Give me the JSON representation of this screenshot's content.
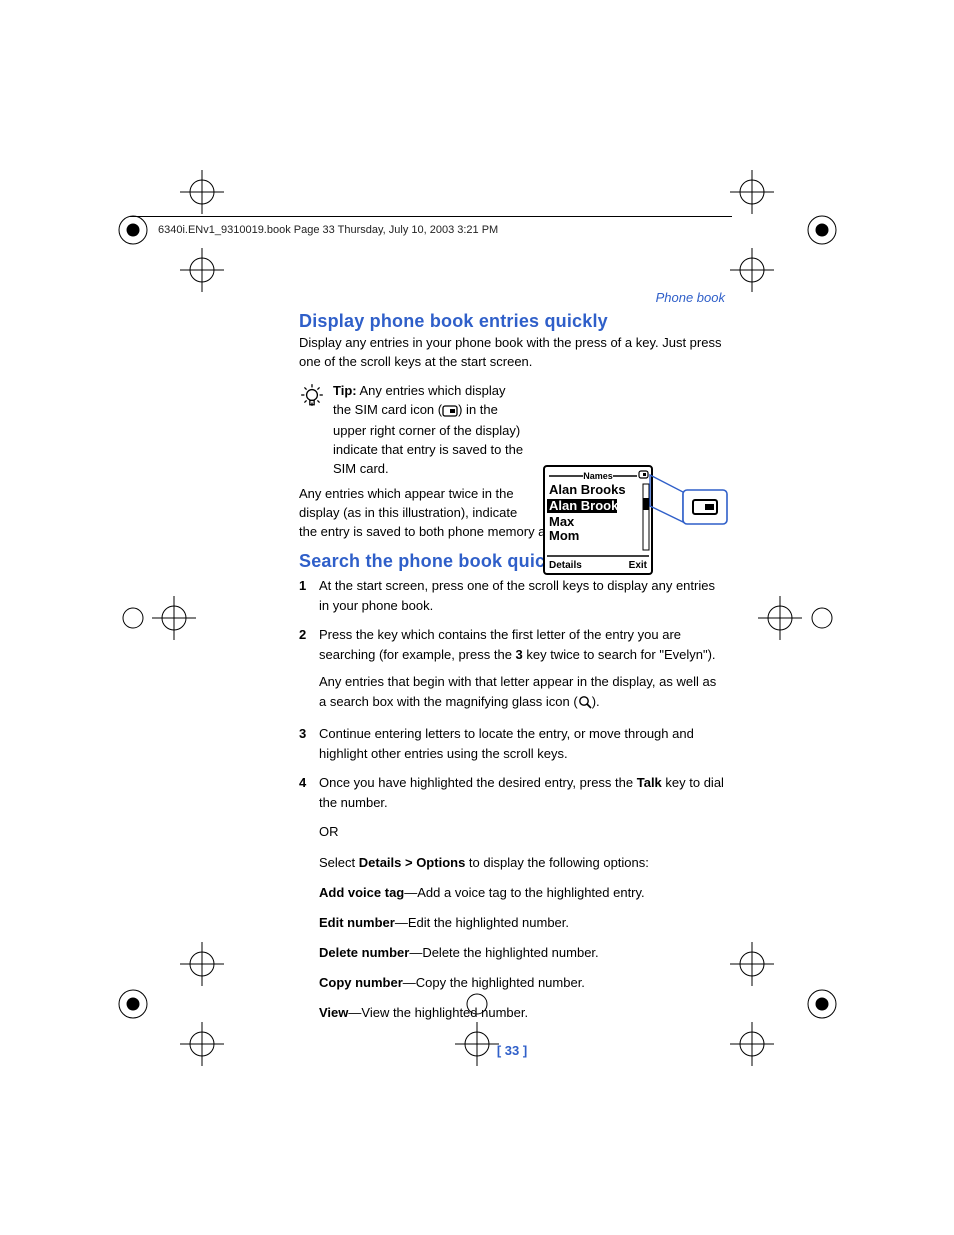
{
  "running_head": "6340i.ENv1_9310019.book  Page 33  Thursday, July 10, 2003  3:21 PM",
  "chapter_label": "Phone book",
  "section1_title": "Display phone book entries quickly",
  "section1_intro": "Display any entries in your phone book with the press of a key. Just press one of the scroll keys at the start screen.",
  "tip_label": "Tip:",
  "tip_text_1": " Any entries which display the SIM card icon (",
  "tip_text_2": ") in the upper right corner of the display) indicate that entry is saved to the SIM card.",
  "dup_entries_text": "Any entries which appear twice in the display (as in this illustration), indicate the entry is saved to both phone memory and SIM memory.",
  "section2_title": "Search the phone book quickly",
  "steps": [
    {
      "text_a": "At the start screen, press one of the scroll keys to display any entries in your phone book."
    },
    {
      "text_a": "Press the key which contains the first letter of the entry you are searching (for example, press the ",
      "bold_a": "3",
      "text_b": " key twice to search for \"Evelyn\").",
      "sub_a": "Any entries that begin with that letter appear in the display, as well as a search box with the magnifying glass icon (",
      "sub_b": ")."
    },
    {
      "text_a": "Continue entering letters to locate the entry, or move through and highlight other entries using the scroll keys."
    },
    {
      "text_a": "Once you have highlighted the desired entry, press the ",
      "bold_a": "Talk",
      "text_b": " key to dial the number."
    }
  ],
  "or_label": "OR",
  "select_prefix": "Select ",
  "select_bold": "Details > Options",
  "select_suffix": " to display the following options:",
  "options": [
    {
      "name": "Add voice tag",
      "desc": "—Add a voice tag to the highlighted entry."
    },
    {
      "name": "Edit number",
      "desc": "—Edit the highlighted number."
    },
    {
      "name": "Delete number",
      "desc": "—Delete the highlighted number."
    },
    {
      "name": "Copy number",
      "desc": "—Copy the highlighted number."
    },
    {
      "name": "View",
      "desc": "—View the highlighted number."
    }
  ],
  "page_num": "[ 33 ]",
  "phone_screen": {
    "header": "Names",
    "entry1": "Alan Brooks",
    "entry2": "Alan Brooks",
    "entry3": "Max",
    "entry4": "Mom",
    "left_soft": "Details",
    "right_soft": "Exit"
  }
}
